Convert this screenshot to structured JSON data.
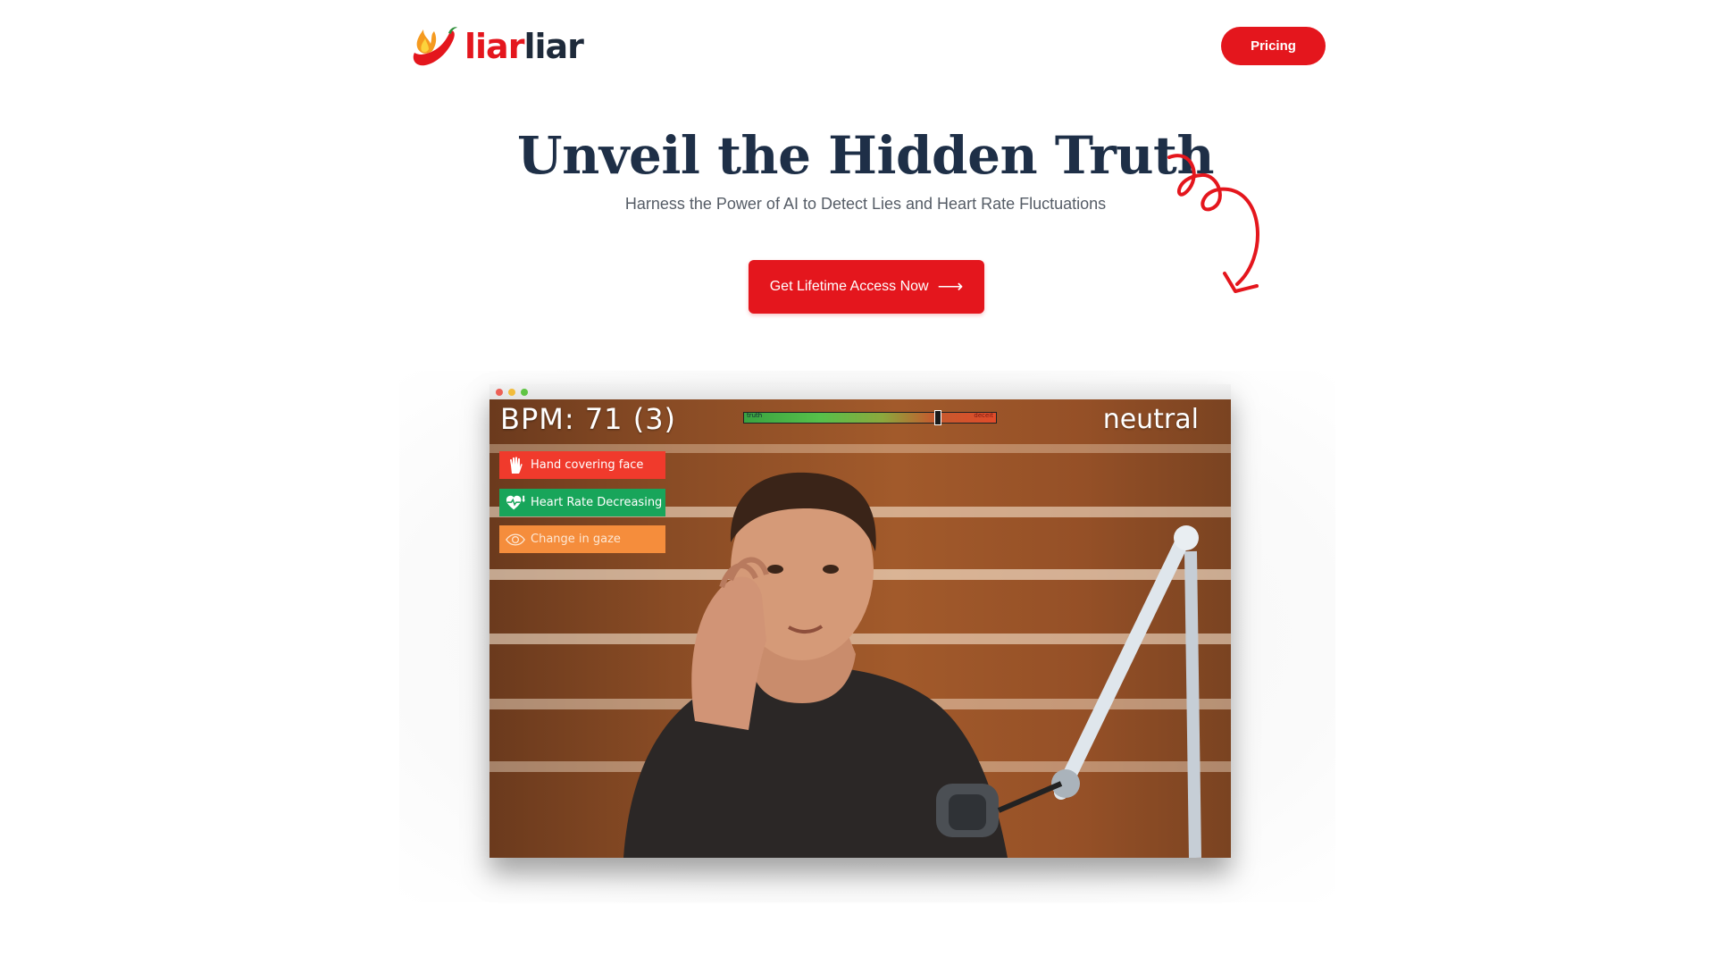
{
  "header": {
    "logo_part1": "liar",
    "logo_part2": "liar",
    "pricing_label": "Pricing"
  },
  "hero": {
    "title_highlight": "Unveil",
    "title_rest": " the Hidden Truth",
    "subtitle": "Harness the Power of AI to Detect Lies and Heart Rate Fluctuations",
    "cta_label": "Get Lifetime Access Now",
    "cta_arrow": "⟶"
  },
  "demo": {
    "bpm_label": "BPM: 71 (3)",
    "emotion": "neutral",
    "meter": {
      "left_label": "truth",
      "right_label": "deceit",
      "level": 0.77
    },
    "flags": [
      {
        "label": "Hand covering face",
        "icon": "hand-icon",
        "color": "#f03a2c"
      },
      {
        "label": "Heart Rate Decreasing",
        "icon": "heart-rate-down-icon",
        "color": "#18a55a"
      },
      {
        "label": "Change in gaze",
        "icon": "eye-icon",
        "color": "#f58d3c"
      }
    ]
  },
  "colors": {
    "brand_red": "#e4161d",
    "heading_navy": "#1e2f47",
    "highlight_orange": "#f2a77f"
  }
}
